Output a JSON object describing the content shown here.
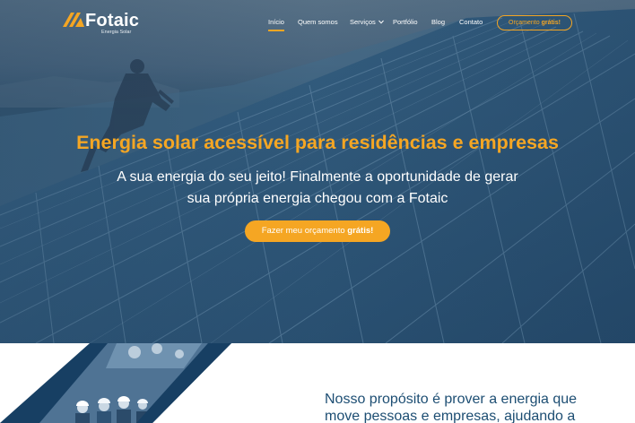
{
  "brand": {
    "name": "Fotaic",
    "tagline": "Energia Solar",
    "accent": "#f5a623",
    "primary": "#1d4e73"
  },
  "nav": {
    "items": [
      {
        "label": "Início",
        "active": true
      },
      {
        "label": "Quem somos"
      },
      {
        "label": "Serviços",
        "has_dropdown": true
      },
      {
        "label": "Portfólio"
      },
      {
        "label": "Blog"
      },
      {
        "label": "Contato"
      }
    ],
    "quote_button": {
      "label": "Orçamento",
      "emphasis": "grátis!"
    }
  },
  "hero": {
    "headline": "Energia solar acessível para residências e empresas",
    "sub_line1": "A sua energia do seu jeito! Finalmente a oportunidade de gerar",
    "sub_line2": "sua própria energia chegou com a Fotaic",
    "cta": {
      "label": "Fazer meu orçamento",
      "emphasis": "grátis!"
    }
  },
  "about": {
    "purpose_line1": "Nosso propósito é prover a energia que",
    "purpose_line2": "move pessoas e empresas, ajudando a"
  }
}
